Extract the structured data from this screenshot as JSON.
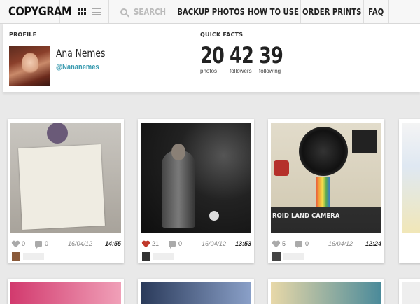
{
  "app": {
    "logo": "COPYGRAM"
  },
  "nav": {
    "search_placeholder": "SEARCH",
    "links": [
      "BACKUP PHOTOS",
      "HOW TO USE",
      "ORDER PRINTS",
      "FAQ"
    ]
  },
  "profile": {
    "section_label": "PROFILE",
    "name": "Ana Nemes",
    "handle": "@Nananemes"
  },
  "quick_facts": {
    "section_label": "QUICK FACTS",
    "items": [
      {
        "value": "20",
        "label": "photos"
      },
      {
        "value": "42",
        "label": "followers"
      },
      {
        "value": "39",
        "label": "following"
      }
    ]
  },
  "photos": [
    {
      "likes": "0",
      "comments": "0",
      "date": "16/04/12",
      "time": "14:55",
      "liked": false
    },
    {
      "likes": "21",
      "comments": "0",
      "date": "16/04/12",
      "time": "13:53",
      "liked": true
    },
    {
      "likes": "5",
      "comments": "0",
      "date": "16/04/12",
      "time": "12:24",
      "liked": false
    }
  ],
  "photo_texts": {
    "camera_label": "ROID LAND CAMERA"
  },
  "colors": {
    "accent": "#3a9bb0",
    "like_active": "#c0392b",
    "like_inactive": "#aaaaaa"
  }
}
